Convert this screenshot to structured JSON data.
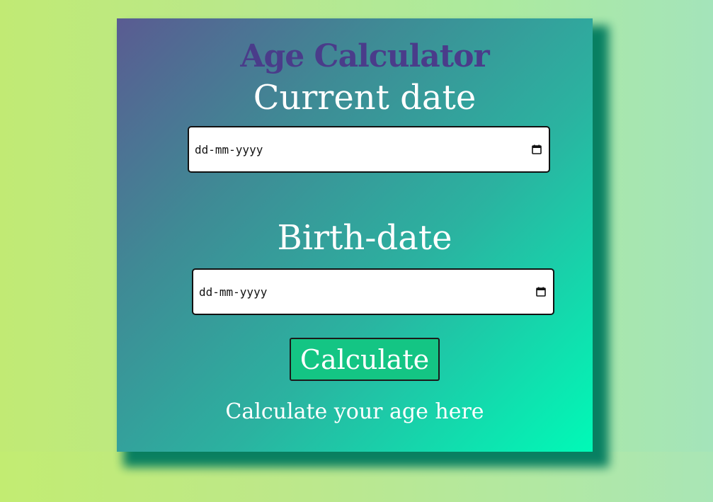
{
  "page": {
    "title": "Age Calculator",
    "result_text": "Calculate your age here"
  },
  "form": {
    "current_date": {
      "label": "Current date",
      "placeholder": "dd-mm-yyyy",
      "icon": "calendar-icon"
    },
    "birth_date": {
      "label": "Birth-date",
      "placeholder": "dd-mm-yyyy",
      "icon": "calendar-icon"
    },
    "calculate_button": "Calculate"
  },
  "colors": {
    "title": "#4a3c8a",
    "card_gradient_start": "#5a5b92",
    "card_gradient_end": "#00fab7",
    "button": "#14c584",
    "shadow": "#007a5e",
    "background": "#c2eb98"
  }
}
